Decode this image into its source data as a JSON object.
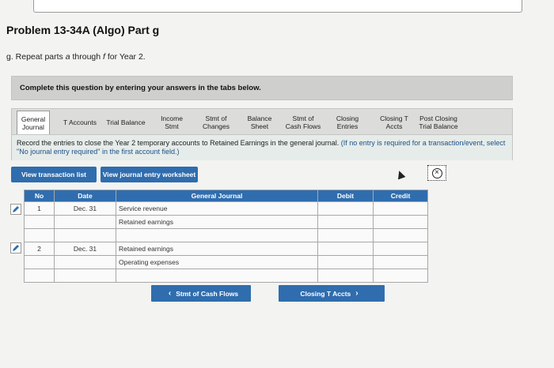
{
  "problem": {
    "title": "Problem 13-34A (Algo) Part g",
    "part_prefix": "g. Repeat parts ",
    "part_a": "a",
    "part_mid": " through ",
    "part_f": "f",
    "part_suffix": " for Year 2."
  },
  "instructions": "Complete this question by entering your answers in the tabs below.",
  "tabs": [
    {
      "line1": "General",
      "line2": "Journal",
      "active": true
    },
    {
      "line1": "T Accounts",
      "line2": ""
    },
    {
      "line1": "Trial Balance",
      "line2": ""
    },
    {
      "line1": "Income",
      "line2": "Stmt"
    },
    {
      "line1": "Stmt of",
      "line2": "Changes"
    },
    {
      "line1": "Balance",
      "line2": "Sheet"
    },
    {
      "line1": "Stmt of",
      "line2": "Cash Flows"
    },
    {
      "line1": "Closing",
      "line2": "Entries"
    },
    {
      "line1": "Closing T",
      "line2": "Accts"
    },
    {
      "line1": "Post Closing",
      "line2": "Trial Balance"
    }
  ],
  "record_text": "Record the entries to close the Year 2 temporary accounts to Retained Earnings in the general journal.",
  "record_note": "(If no entry is required for a transaction/event, select \"No journal entry required\" in the first account field.)",
  "buttons": {
    "view_transaction_list": "View transaction list",
    "view_journal_worksheet": "View journal entry worksheet",
    "prev": "Stmt of Cash Flows",
    "next": "Closing T Accts"
  },
  "table": {
    "headers": {
      "no": "No",
      "date": "Date",
      "journal": "General Journal",
      "debit": "Debit",
      "credit": "Credit"
    },
    "rows": [
      {
        "no": "1",
        "date": "Dec. 31",
        "account": "Service revenue",
        "debit": "",
        "credit": ""
      },
      {
        "no": "",
        "date": "",
        "account": "Retained earnings",
        "debit": "",
        "credit": ""
      },
      {
        "no": "",
        "date": "",
        "account": "",
        "debit": "",
        "credit": ""
      },
      {
        "no": "2",
        "date": "Dec. 31",
        "account": "Retained earnings",
        "debit": "",
        "credit": ""
      },
      {
        "no": "",
        "date": "",
        "account": "Operating expenses",
        "debit": "",
        "credit": ""
      },
      {
        "no": "",
        "date": "",
        "account": "",
        "debit": "",
        "credit": ""
      }
    ]
  },
  "colors": {
    "accent": "#2f6dae",
    "tab_bar": "#dcddda"
  }
}
